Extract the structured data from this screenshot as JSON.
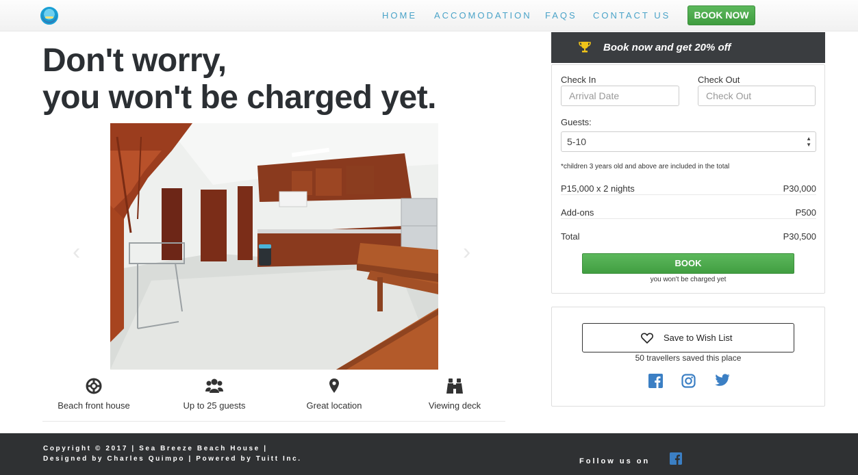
{
  "nav": {
    "links": [
      "HOME",
      "ACCOMODATION",
      "FAQS",
      "CONTACT US"
    ],
    "book_now": "BOOK NOW"
  },
  "hero": {
    "line1": "Don't worry,",
    "line2": "you won't be charged yet."
  },
  "features": [
    {
      "icon": "lifebuoy-icon",
      "label": "Beach front house"
    },
    {
      "icon": "users-icon",
      "label": "Up to 25 guests"
    },
    {
      "icon": "map-pin-icon",
      "label": "Great location"
    },
    {
      "icon": "binoculars-icon",
      "label": "Viewing deck"
    }
  ],
  "booking": {
    "promo": "Book now and get 20% off",
    "check_in_label": "Check In",
    "check_in_placeholder": "Arrival Date",
    "check_out_label": "Check Out",
    "check_out_placeholder": "Check Out",
    "guests_label": "Guests:",
    "guests_value": "5-10",
    "note": "*children 3 years old and above are included in the total",
    "rate_label": "P15,000 x 2 nights",
    "rate_value": "P30,000",
    "addons_label": "Add-ons",
    "addons_value": "P500",
    "total_label": "Total",
    "total_value": "P30,500",
    "book_button": "BOOK",
    "book_note": "you won't be charged yet"
  },
  "wishlist": {
    "button": "Save to Wish List",
    "saved_text": "50 travellers saved this place",
    "social_icons": [
      "facebook-icon",
      "instagram-icon",
      "twitter-icon"
    ]
  },
  "footer": {
    "copyright_line1": "Copyright © 2017 | Sea Breeze Beach House |",
    "copyright_line2": "Designed by Charles Quimpo | Powered by Tuitt Inc.",
    "follow": "Follow us on"
  },
  "colors": {
    "accent_green": "#4cae4c",
    "nav_link": "#4aa3c8",
    "dark": "#3a3d40",
    "social_blue": "#3b7fc4"
  }
}
